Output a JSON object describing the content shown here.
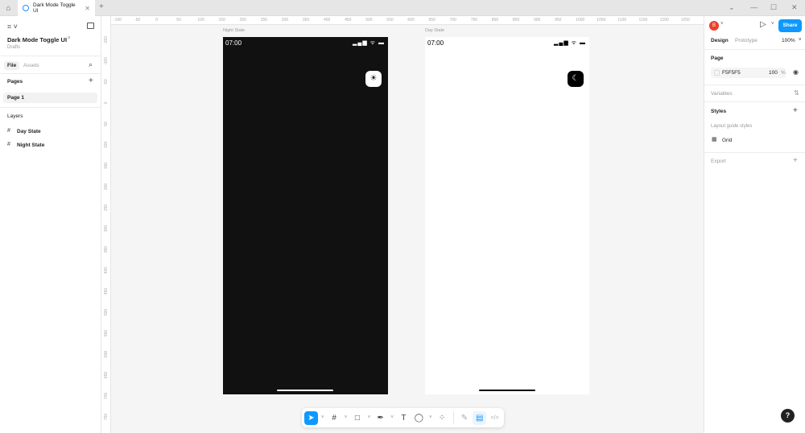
{
  "tab": {
    "title": "Dark Mode Toggle UI"
  },
  "left": {
    "file_name": "Dark Mode Toggle UI",
    "location": "Drafts",
    "tabs": [
      "File",
      "Assets"
    ],
    "pages_heading": "Pages",
    "pages": [
      "Page 1"
    ],
    "layers_heading": "Layers",
    "layers": [
      "Day State",
      "Night State"
    ]
  },
  "rulers": {
    "h": [
      "-100",
      "-50",
      "0",
      "50",
      "100",
      "150",
      "200",
      "250",
      "300",
      "350",
      "400",
      "450",
      "500",
      "550",
      "600",
      "650",
      "700",
      "750",
      "800",
      "850",
      "900",
      "950",
      "1000",
      "1050",
      "1100",
      "1150",
      "1200",
      "1250"
    ],
    "v": [
      "-150",
      "-100",
      "-50",
      "0",
      "50",
      "100",
      "150",
      "200",
      "250",
      "300",
      "350",
      "400",
      "450",
      "500",
      "550",
      "600",
      "650",
      "700",
      "750"
    ]
  },
  "frames": [
    {
      "label": "Night State",
      "time": "07:00",
      "bg": "#111111",
      "fg": "#ffffff",
      "toggle_icon": "☀"
    },
    {
      "label": "Day State",
      "time": "07:00",
      "bg": "#ffffff",
      "fg": "#000000",
      "toggle_icon": "☾"
    }
  ],
  "right": {
    "avatar": "B",
    "share": "Share",
    "tabs": [
      "Design",
      "Prototype"
    ],
    "zoom": "100%",
    "page_heading": "Page",
    "page_color": "F5F5F5",
    "page_opacity": "100",
    "percent": "%",
    "variables": "Variables",
    "styles": "Styles",
    "layout_guide_styles": "Layout guide styles",
    "grid": "Grid",
    "export": "Export"
  },
  "help": "?"
}
